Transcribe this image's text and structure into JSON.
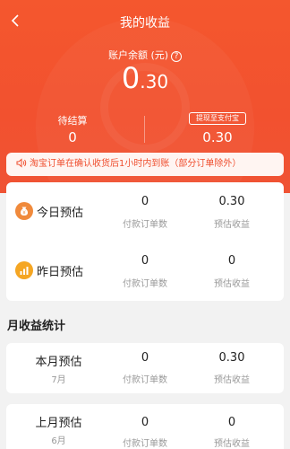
{
  "header": {
    "title": "我的收益"
  },
  "balance": {
    "label": "账户余额 (元)",
    "help_icon": "?",
    "value_int": "0",
    "value_dec": ".30"
  },
  "pending": {
    "label": "待结算",
    "value": "0"
  },
  "withdraw": {
    "button_label": "提现至支付宝",
    "value": "0.30"
  },
  "notice": {
    "icon": "speaker-icon",
    "text": "淘宝订单在确认收货后1小时内到账（部分订单除外）"
  },
  "estimates": [
    {
      "label": "今日预估",
      "icon": "money-bag-icon",
      "orders": "0",
      "orders_caption": "付款订单数",
      "income": "0.30",
      "income_caption": "预估收益"
    },
    {
      "label": "昨日预估",
      "icon": "bar-chart-icon",
      "orders": "0",
      "orders_caption": "付款订单数",
      "income": "0",
      "income_caption": "预估收益"
    }
  ],
  "monthly": {
    "title": "月收益统计",
    "rows": [
      {
        "label": "本月预估",
        "sub": "7月",
        "orders": "0",
        "orders_caption": "付款订单数",
        "income": "0.30",
        "income_caption": "预估收益"
      },
      {
        "label": "上月预估",
        "sub": "6月",
        "orders": "0",
        "orders_caption": "付款订单数",
        "income": "0",
        "income_caption": "预估收益"
      }
    ]
  },
  "colors": {
    "accent": "#f2512f",
    "notice_bg": "#fff5f2",
    "icon_orange": "#f08a3c",
    "icon_gold": "#f5a623"
  }
}
